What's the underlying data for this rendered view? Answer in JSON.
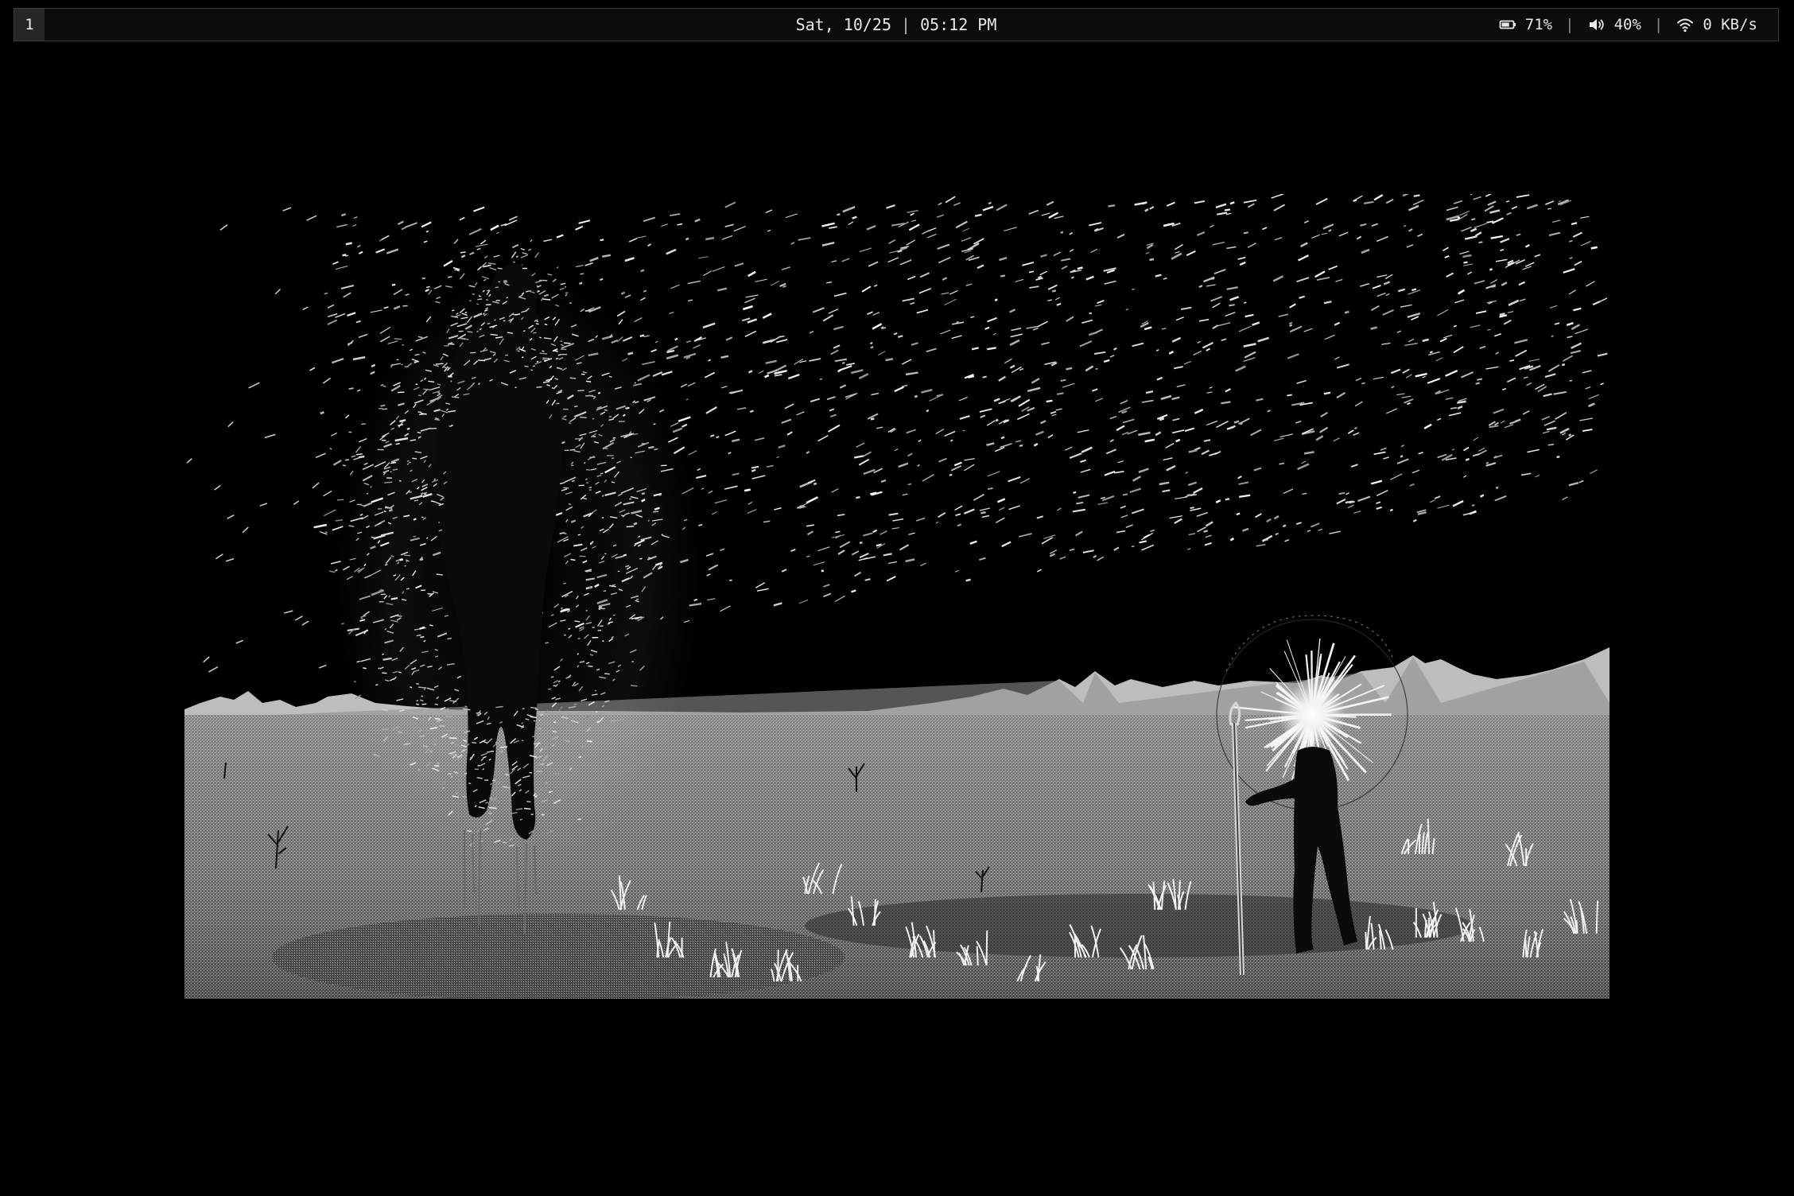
{
  "bar": {
    "workspace": "1",
    "clock": {
      "date": "Sat, 10/25",
      "separator": "|",
      "time": "05:12 PM"
    },
    "status": {
      "battery": {
        "icon": "battery-icon",
        "value": "71%",
        "level": 0.71
      },
      "separator": "|",
      "volume": {
        "icon": "speaker-icon",
        "value": "40%",
        "level": 0.4
      },
      "network": {
        "icon": "wifi-icon",
        "value": "0 KB/s"
      }
    }
  },
  "colors": {
    "bar_bg": "#0c0c0c",
    "bar_border": "#3a3a3a",
    "workspace_bg": "#262626",
    "text": "#e6e6e6",
    "desktop_bg": "#000000"
  }
}
